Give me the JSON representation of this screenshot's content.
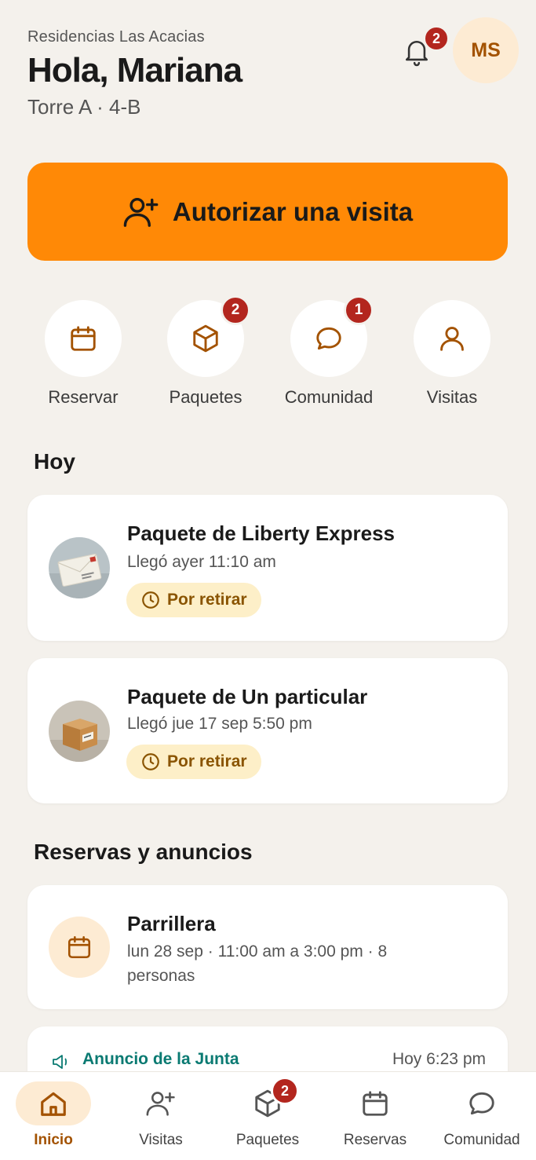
{
  "header": {
    "community": "Residencias Las Acacias",
    "greeting": "Hola, Mariana",
    "unit": "Torre A · 4-B",
    "notifications_count": "2",
    "avatar_initials": "MS"
  },
  "cta": {
    "label": "Autorizar una visita"
  },
  "quick_actions": [
    {
      "label": "Reservar",
      "icon": "calendar-icon",
      "badge": ""
    },
    {
      "label": "Paquetes",
      "icon": "package-icon",
      "badge": "2"
    },
    {
      "label": "Comunidad",
      "icon": "chat-bubble-icon",
      "badge": "1"
    },
    {
      "label": "Visitas",
      "icon": "person-icon",
      "badge": ""
    }
  ],
  "today": {
    "title": "Hoy",
    "items": [
      {
        "title": "Paquete de Liberty Express",
        "subtitle": "Llegó ayer 11:10 am",
        "status": "Por retirar",
        "thumb": "envelope-image"
      },
      {
        "title": "Paquete de Un particular",
        "subtitle": "Llegó jue 17 sep 5:50 pm",
        "status": "Por retirar",
        "thumb": "box-image"
      }
    ]
  },
  "reservations": {
    "title": "Reservas y anuncios",
    "reservation": {
      "title": "Parrillera",
      "line1": "lun 28 sep · 11:00 am a 3:00 pm · 8",
      "line2": "personas",
      "icon": "calendar-icon"
    },
    "announcement": {
      "title": "Anuncio de la Junta",
      "time": "Hoy 6:23 pm",
      "icon": "megaphone-icon"
    }
  },
  "tabbar": [
    {
      "label": "Inicio",
      "icon": "home-icon",
      "active": true,
      "badge": ""
    },
    {
      "label": "Visitas",
      "icon": "person-add-icon",
      "active": false,
      "badge": ""
    },
    {
      "label": "Paquetes",
      "icon": "package-icon",
      "active": false,
      "badge": "2"
    },
    {
      "label": "Reservas",
      "icon": "calendar-icon",
      "active": false,
      "badge": ""
    },
    {
      "label": "Comunidad",
      "icon": "chat-bubble-icon",
      "active": false,
      "badge": ""
    }
  ],
  "colors": {
    "accent": "#ff8906",
    "background": "#f4f1ec",
    "badge": "#b3261e",
    "announcement": "#0a7a72",
    "brown": "#a35200"
  }
}
